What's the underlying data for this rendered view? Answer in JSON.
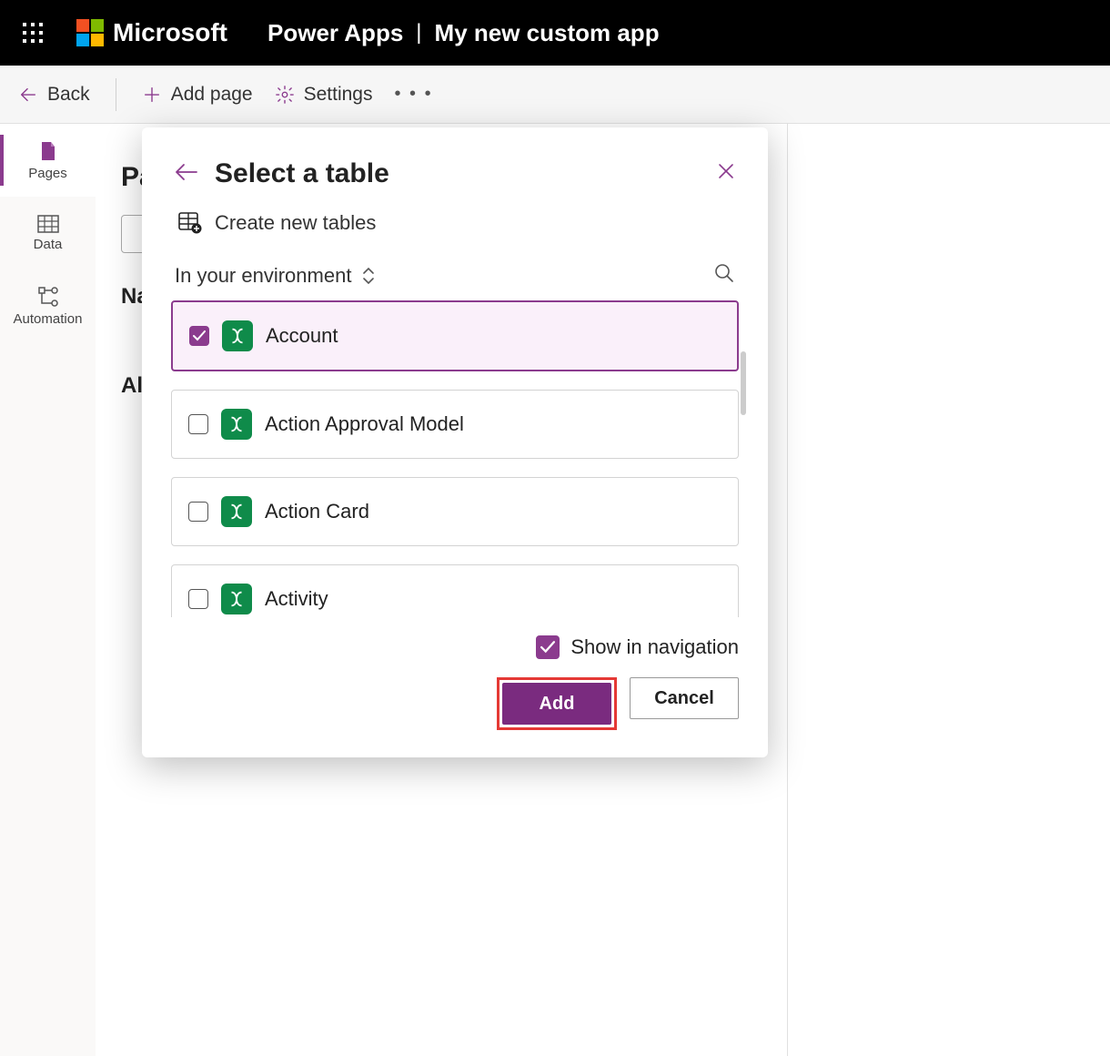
{
  "topbar": {
    "brand": "Microsoft",
    "app": "Power Apps",
    "doc": "My new custom app"
  },
  "toolbar": {
    "back": "Back",
    "add_page": "Add page",
    "settings": "Settings"
  },
  "rail": {
    "pages": "Pages",
    "data": "Data",
    "automation": "Automation"
  },
  "main": {
    "heading": "Pages",
    "section_nav": "Navigation",
    "section_all": "All other pages"
  },
  "dialog": {
    "title": "Select a table",
    "create_new": "Create new tables",
    "filter_label": "In your environment",
    "tables": [
      {
        "label": "Account",
        "selected": true
      },
      {
        "label": "Action Approval Model",
        "selected": false
      },
      {
        "label": "Action Card",
        "selected": false
      },
      {
        "label": "Activity",
        "selected": false
      }
    ],
    "show_in_nav": "Show in navigation",
    "add": "Add",
    "cancel": "Cancel"
  }
}
